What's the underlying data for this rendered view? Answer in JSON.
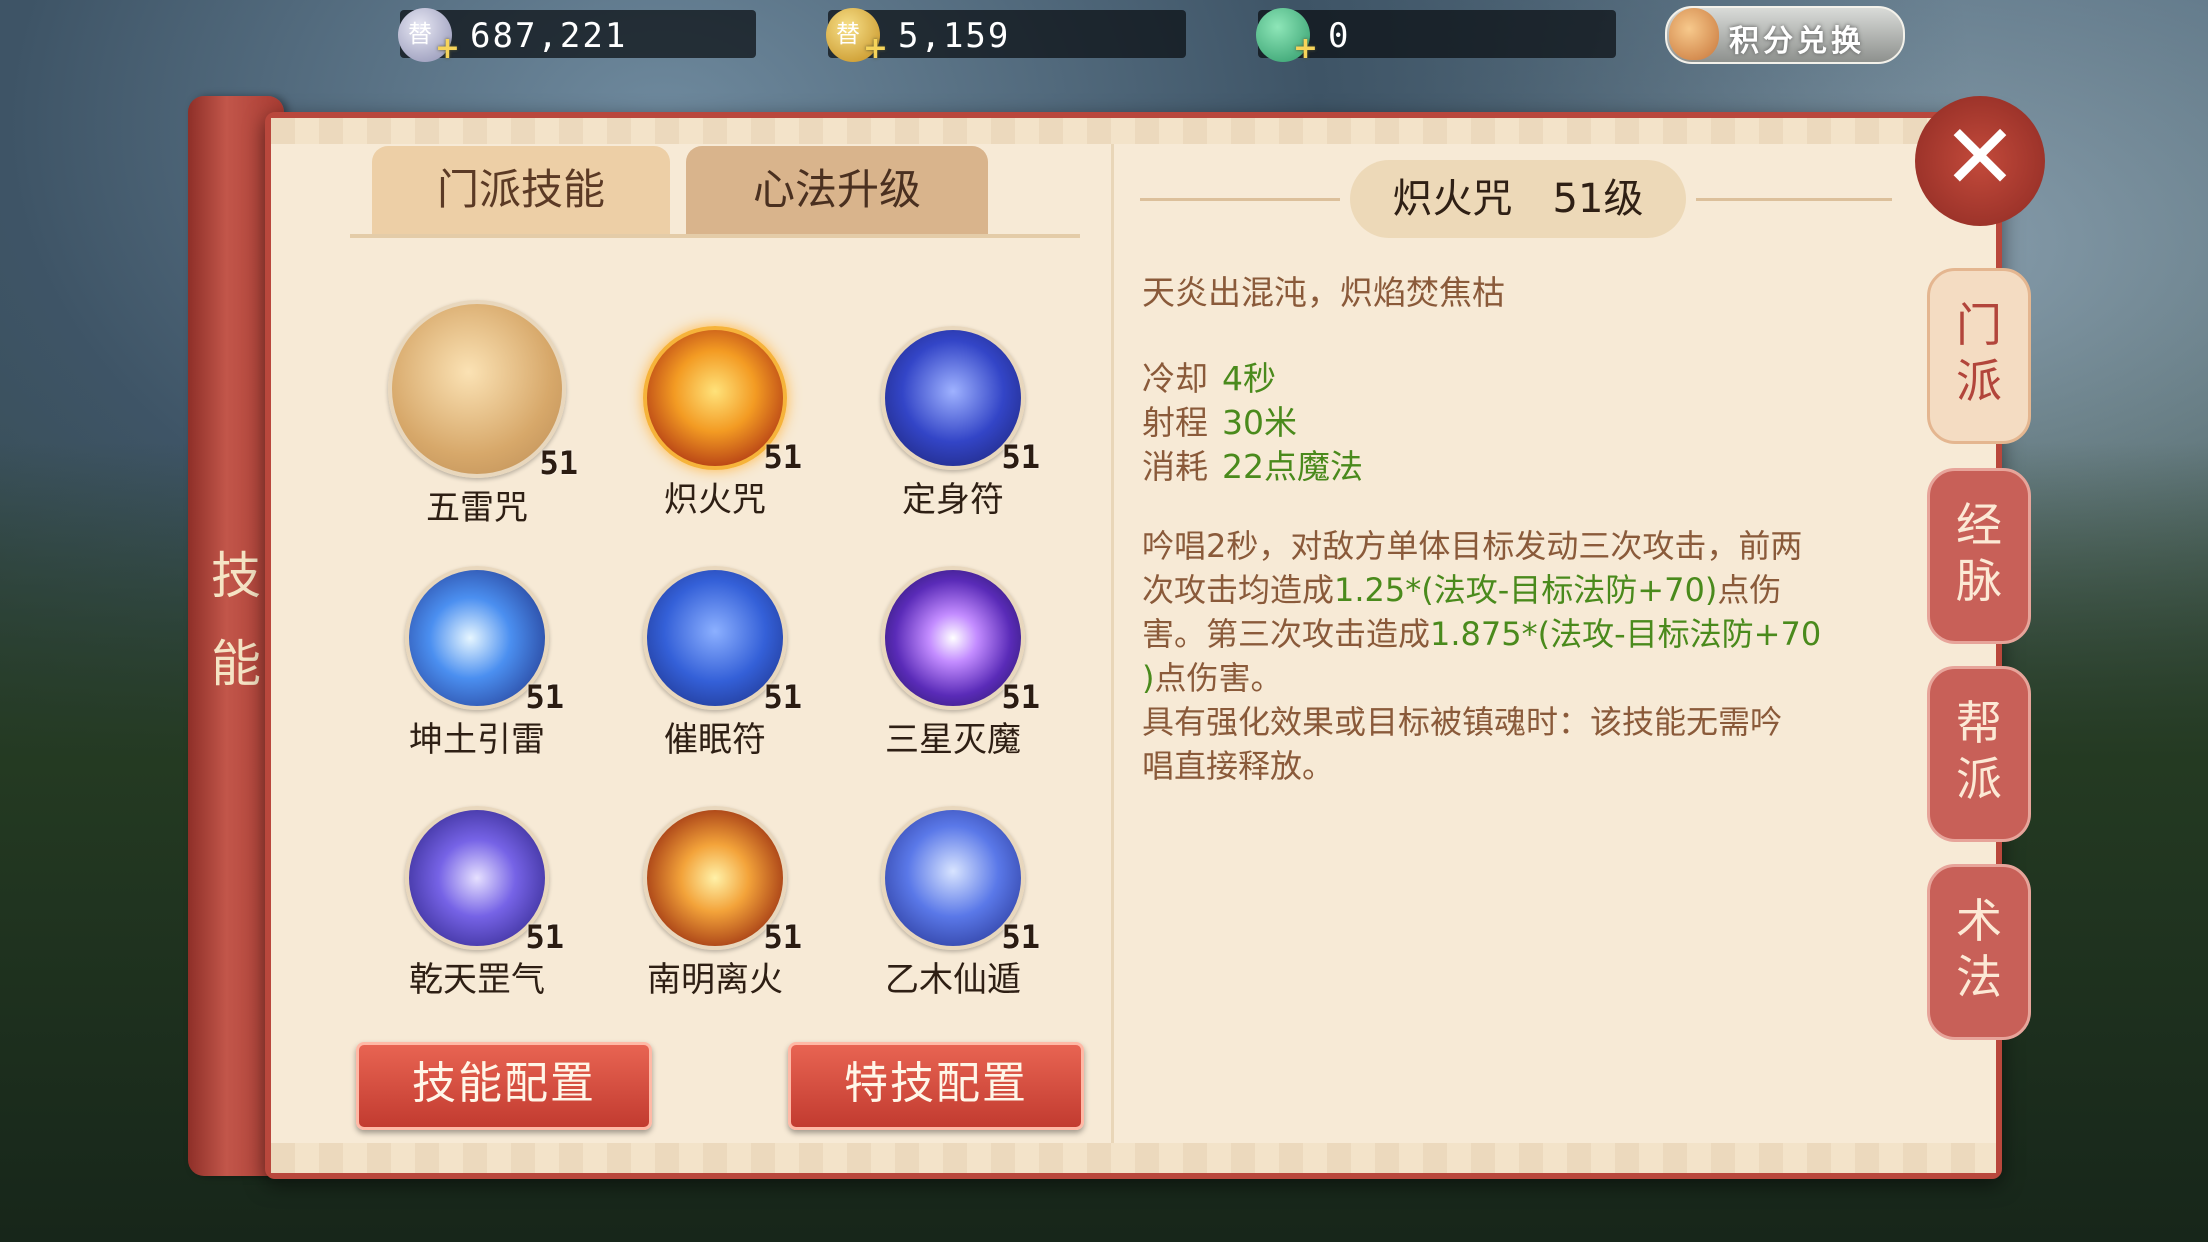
{
  "currency": {
    "silver": "687,221",
    "gold": "5,159",
    "jade": "0",
    "exchange_label": "积分兑换"
  },
  "left_scroll": {
    "title_top": "技",
    "title_bottom": "能"
  },
  "tabs": [
    {
      "label": "门派技能",
      "active": true
    },
    {
      "label": "心法升级",
      "active": false
    }
  ],
  "skills": [
    {
      "name": "五雷咒",
      "level": "51"
    },
    {
      "name": "炽火咒",
      "level": "51"
    },
    {
      "name": "定身符",
      "level": "51"
    },
    {
      "name": "坤土引雷",
      "level": "51"
    },
    {
      "name": "催眠符",
      "level": "51"
    },
    {
      "name": "三星灭魔",
      "level": "51"
    },
    {
      "name": "乾天罡气",
      "level": "51"
    },
    {
      "name": "南明离火",
      "level": "51"
    },
    {
      "name": "乙木仙遁",
      "level": "51"
    }
  ],
  "buttons": {
    "skill_config": "技能配置",
    "special_config": "特技配置"
  },
  "detail": {
    "title": "炽火咒　51级",
    "flavor": "天炎出混沌，炽焰焚焦枯",
    "stats": [
      {
        "label": "冷却",
        "value": "4秒"
      },
      {
        "label": "射程",
        "value": "30米"
      },
      {
        "label": "消耗",
        "value": "22点魔法"
      }
    ],
    "desc_1": "吟唱2秒，对敌方单体目标发动三次攻击，前两",
    "desc_2a": "次攻击均造成",
    "desc_2b": "1.25*(法攻-目标法防+70)",
    "desc_2c": "点伤",
    "desc_3a": "害。第三次攻击造成",
    "desc_3b": "1.875*(法攻-目标法防+70",
    "desc_4a": ")",
    "desc_4b": "点伤害。",
    "desc_5": "具有强化效果或目标被镇魂时：该技能无需吟",
    "desc_6": "唱直接释放。"
  },
  "side_tabs": [
    {
      "label_1": "门",
      "label_2": "派",
      "active": true
    },
    {
      "label_1": "经",
      "label_2": "脉",
      "active": false
    },
    {
      "label_1": "帮",
      "label_2": "派",
      "active": false
    },
    {
      "label_1": "术",
      "label_2": "法",
      "active": false
    }
  ],
  "colors": {
    "accent_red": "#c23b30",
    "green_value": "#4a8a1c",
    "panel_bg": "#f7ead6"
  }
}
